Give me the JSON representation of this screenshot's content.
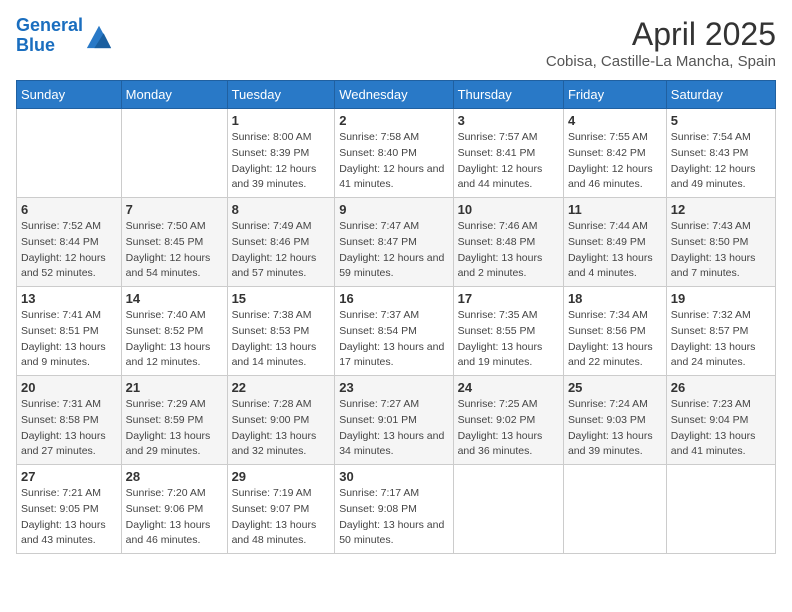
{
  "header": {
    "logo_general": "General",
    "logo_blue": "Blue",
    "title": "April 2025",
    "subtitle": "Cobisa, Castille-La Mancha, Spain"
  },
  "weekdays": [
    "Sunday",
    "Monday",
    "Tuesday",
    "Wednesday",
    "Thursday",
    "Friday",
    "Saturday"
  ],
  "weeks": [
    [
      {
        "day": "",
        "sunrise": "",
        "sunset": "",
        "daylight": ""
      },
      {
        "day": "",
        "sunrise": "",
        "sunset": "",
        "daylight": ""
      },
      {
        "day": "1",
        "sunrise": "Sunrise: 8:00 AM",
        "sunset": "Sunset: 8:39 PM",
        "daylight": "Daylight: 12 hours and 39 minutes."
      },
      {
        "day": "2",
        "sunrise": "Sunrise: 7:58 AM",
        "sunset": "Sunset: 8:40 PM",
        "daylight": "Daylight: 12 hours and 41 minutes."
      },
      {
        "day": "3",
        "sunrise": "Sunrise: 7:57 AM",
        "sunset": "Sunset: 8:41 PM",
        "daylight": "Daylight: 12 hours and 44 minutes."
      },
      {
        "day": "4",
        "sunrise": "Sunrise: 7:55 AM",
        "sunset": "Sunset: 8:42 PM",
        "daylight": "Daylight: 12 hours and 46 minutes."
      },
      {
        "day": "5",
        "sunrise": "Sunrise: 7:54 AM",
        "sunset": "Sunset: 8:43 PM",
        "daylight": "Daylight: 12 hours and 49 minutes."
      }
    ],
    [
      {
        "day": "6",
        "sunrise": "Sunrise: 7:52 AM",
        "sunset": "Sunset: 8:44 PM",
        "daylight": "Daylight: 12 hours and 52 minutes."
      },
      {
        "day": "7",
        "sunrise": "Sunrise: 7:50 AM",
        "sunset": "Sunset: 8:45 PM",
        "daylight": "Daylight: 12 hours and 54 minutes."
      },
      {
        "day": "8",
        "sunrise": "Sunrise: 7:49 AM",
        "sunset": "Sunset: 8:46 PM",
        "daylight": "Daylight: 12 hours and 57 minutes."
      },
      {
        "day": "9",
        "sunrise": "Sunrise: 7:47 AM",
        "sunset": "Sunset: 8:47 PM",
        "daylight": "Daylight: 12 hours and 59 minutes."
      },
      {
        "day": "10",
        "sunrise": "Sunrise: 7:46 AM",
        "sunset": "Sunset: 8:48 PM",
        "daylight": "Daylight: 13 hours and 2 minutes."
      },
      {
        "day": "11",
        "sunrise": "Sunrise: 7:44 AM",
        "sunset": "Sunset: 8:49 PM",
        "daylight": "Daylight: 13 hours and 4 minutes."
      },
      {
        "day": "12",
        "sunrise": "Sunrise: 7:43 AM",
        "sunset": "Sunset: 8:50 PM",
        "daylight": "Daylight: 13 hours and 7 minutes."
      }
    ],
    [
      {
        "day": "13",
        "sunrise": "Sunrise: 7:41 AM",
        "sunset": "Sunset: 8:51 PM",
        "daylight": "Daylight: 13 hours and 9 minutes."
      },
      {
        "day": "14",
        "sunrise": "Sunrise: 7:40 AM",
        "sunset": "Sunset: 8:52 PM",
        "daylight": "Daylight: 13 hours and 12 minutes."
      },
      {
        "day": "15",
        "sunrise": "Sunrise: 7:38 AM",
        "sunset": "Sunset: 8:53 PM",
        "daylight": "Daylight: 13 hours and 14 minutes."
      },
      {
        "day": "16",
        "sunrise": "Sunrise: 7:37 AM",
        "sunset": "Sunset: 8:54 PM",
        "daylight": "Daylight: 13 hours and 17 minutes."
      },
      {
        "day": "17",
        "sunrise": "Sunrise: 7:35 AM",
        "sunset": "Sunset: 8:55 PM",
        "daylight": "Daylight: 13 hours and 19 minutes."
      },
      {
        "day": "18",
        "sunrise": "Sunrise: 7:34 AM",
        "sunset": "Sunset: 8:56 PM",
        "daylight": "Daylight: 13 hours and 22 minutes."
      },
      {
        "day": "19",
        "sunrise": "Sunrise: 7:32 AM",
        "sunset": "Sunset: 8:57 PM",
        "daylight": "Daylight: 13 hours and 24 minutes."
      }
    ],
    [
      {
        "day": "20",
        "sunrise": "Sunrise: 7:31 AM",
        "sunset": "Sunset: 8:58 PM",
        "daylight": "Daylight: 13 hours and 27 minutes."
      },
      {
        "day": "21",
        "sunrise": "Sunrise: 7:29 AM",
        "sunset": "Sunset: 8:59 PM",
        "daylight": "Daylight: 13 hours and 29 minutes."
      },
      {
        "day": "22",
        "sunrise": "Sunrise: 7:28 AM",
        "sunset": "Sunset: 9:00 PM",
        "daylight": "Daylight: 13 hours and 32 minutes."
      },
      {
        "day": "23",
        "sunrise": "Sunrise: 7:27 AM",
        "sunset": "Sunset: 9:01 PM",
        "daylight": "Daylight: 13 hours and 34 minutes."
      },
      {
        "day": "24",
        "sunrise": "Sunrise: 7:25 AM",
        "sunset": "Sunset: 9:02 PM",
        "daylight": "Daylight: 13 hours and 36 minutes."
      },
      {
        "day": "25",
        "sunrise": "Sunrise: 7:24 AM",
        "sunset": "Sunset: 9:03 PM",
        "daylight": "Daylight: 13 hours and 39 minutes."
      },
      {
        "day": "26",
        "sunrise": "Sunrise: 7:23 AM",
        "sunset": "Sunset: 9:04 PM",
        "daylight": "Daylight: 13 hours and 41 minutes."
      }
    ],
    [
      {
        "day": "27",
        "sunrise": "Sunrise: 7:21 AM",
        "sunset": "Sunset: 9:05 PM",
        "daylight": "Daylight: 13 hours and 43 minutes."
      },
      {
        "day": "28",
        "sunrise": "Sunrise: 7:20 AM",
        "sunset": "Sunset: 9:06 PM",
        "daylight": "Daylight: 13 hours and 46 minutes."
      },
      {
        "day": "29",
        "sunrise": "Sunrise: 7:19 AM",
        "sunset": "Sunset: 9:07 PM",
        "daylight": "Daylight: 13 hours and 48 minutes."
      },
      {
        "day": "30",
        "sunrise": "Sunrise: 7:17 AM",
        "sunset": "Sunset: 9:08 PM",
        "daylight": "Daylight: 13 hours and 50 minutes."
      },
      {
        "day": "",
        "sunrise": "",
        "sunset": "",
        "daylight": ""
      },
      {
        "day": "",
        "sunrise": "",
        "sunset": "",
        "daylight": ""
      },
      {
        "day": "",
        "sunrise": "",
        "sunset": "",
        "daylight": ""
      }
    ]
  ]
}
